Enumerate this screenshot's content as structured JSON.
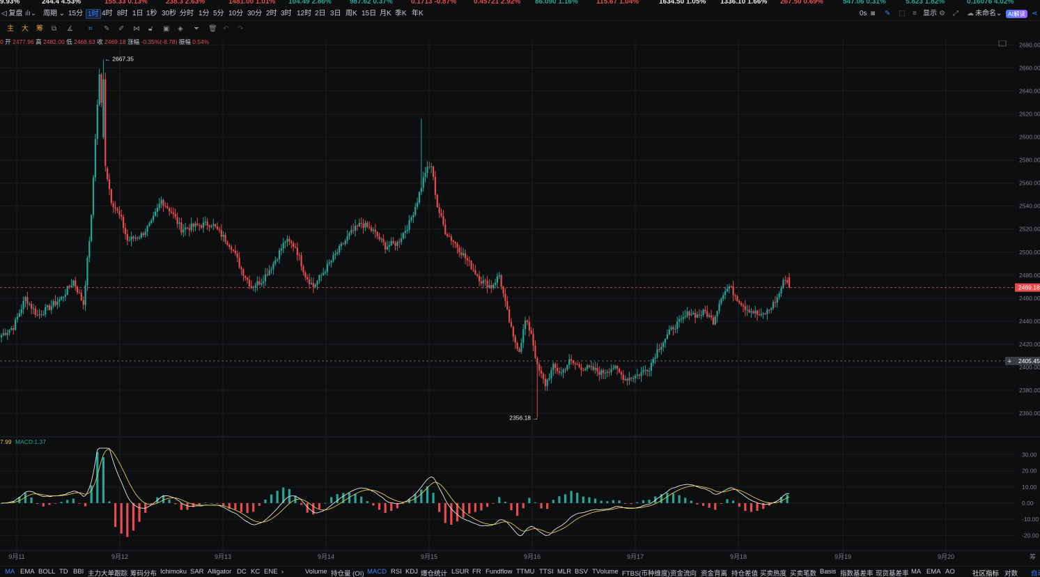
{
  "ticker": [
    {
      "text": "9.93%",
      "color": "#e8e8e8"
    },
    {
      "text": "244.4 4.53%",
      "color": "#e8e8e8"
    },
    {
      "text": "155.33 0.13%",
      "color": "#e84c4c"
    },
    {
      "text": "238.3 2.63%",
      "color": "#e84c4c"
    },
    {
      "text": "1481.00 1.01%",
      "color": "#e84c4c"
    },
    {
      "text": "104.49 2.86%",
      "color": "#26a69a"
    },
    {
      "text": "987.62 0.37%",
      "color": "#26a69a"
    },
    {
      "text": "0.1713 -0.87%",
      "color": "#e84c4c"
    },
    {
      "text": "0.45721 2.92%",
      "color": "#e84c4c"
    },
    {
      "text": "86.090 1.16%",
      "color": "#26a69a"
    },
    {
      "text": "115.67 1.04%",
      "color": "#e84c4c"
    },
    {
      "text": "1634.50 1.05%",
      "color": "#e8e8e8"
    },
    {
      "text": "1336.10 1.66%",
      "color": "#e8e8e8"
    },
    {
      "text": "267.50 0.69%",
      "color": "#e84c4c"
    },
    {
      "text": "547.06 0.31%",
      "color": "#26a69a"
    },
    {
      "text": "5.823 1.82%",
      "color": "#26a69a"
    },
    {
      "text": "0.16076 4.02%",
      "color": "#26a69a"
    }
  ],
  "toolbar": {
    "replay": "复盘",
    "period": "周期",
    "intervals": [
      "15分",
      "1时",
      "4时",
      "8时",
      "1日",
      "1秒",
      "30秒",
      "分时",
      "1分",
      "5分",
      "10分",
      "30分",
      "2时",
      "3时",
      "12时",
      "2日",
      "3日",
      "周K",
      "15日",
      "月K",
      "季K",
      "年K"
    ],
    "active_interval": "1时",
    "right_timer": "0s",
    "display": "显示",
    "layout_name": "未命名",
    "ai_label": "AI解读"
  },
  "drawing_tools": [
    "主",
    "大",
    "筹"
  ],
  "ohlc_info": {
    "open_label": "开",
    "open": "2477.96",
    "high_label": "高",
    "high": "2482.00",
    "low_label": "低",
    "low": "2468.63",
    "close_label": "收",
    "close": "2469.18",
    "change_label": "涨幅",
    "change": "-0.35%(-8.78)",
    "amp_label": "振幅",
    "amp": "0.54%"
  },
  "macd_info": {
    "dea": "7.99",
    "macd_label": "MACD:1.37"
  },
  "price_labels": {
    "high_marker": "2667.35",
    "low_marker": "2356.18",
    "current": "2469.18",
    "crosshair": "2405.45"
  },
  "chart_data": {
    "type": "candlestick",
    "y_ticks": [
      2360,
      2380,
      2400,
      2420,
      2440,
      2460,
      2480,
      2500,
      2520,
      2540,
      2560,
      2580,
      2600,
      2620,
      2640,
      2660,
      2680
    ],
    "ylim": [
      2344,
      2684
    ],
    "x_dates": [
      "9月11",
      "9月12",
      "9月13",
      "9月14",
      "9月15",
      "9月16",
      "9月17",
      "9月18",
      "9月19",
      "9月20"
    ],
    "macd_ticks": [
      "30.00",
      "20.00",
      "10.00",
      "0.00",
      "-10.00",
      "-20.00"
    ],
    "macd_ylim": [
      -30,
      36
    ],
    "bull_color": "#26a69a",
    "bear_color": "#e84c4c",
    "dif_color": "#e8e8e8",
    "dea_color": "#e6c84a"
  },
  "bottom": {
    "main_indicators": [
      "MA",
      "EMA",
      "BOLL",
      "TD",
      "BBI",
      "主力大单跟踪",
      "筹码分布",
      "Ichimoku",
      "SAR",
      "Alligator",
      "DC",
      "KC",
      "ENE"
    ],
    "sub_indicators": [
      "Volume",
      "持仓量 (OI)",
      "MACD",
      "RSI",
      "KDJ",
      "爆仓统计",
      "LSUR",
      "FR",
      "Fundflow",
      "TTMU",
      "TTSI",
      "MLR",
      "BSV",
      "TVolume",
      "FTBS(币种维度)",
      "资金流向",
      "资金背离",
      "持仓差值",
      "买卖热度",
      "买卖笔数",
      "Basis",
      "指数基差率",
      "现货基差率",
      "MA",
      "EMA",
      "AO"
    ],
    "community": "社区指标",
    "compare": "对数",
    "auto": "自动"
  }
}
